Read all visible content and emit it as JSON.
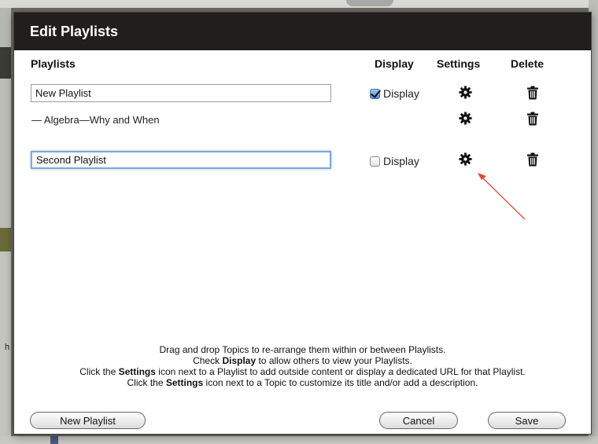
{
  "dialog": {
    "title": "Edit Playlists"
  },
  "columns": {
    "playlists": "Playlists",
    "display": "Display",
    "settings": "Settings",
    "delete": "Delete"
  },
  "rows": [
    {
      "type": "playlist",
      "name": "New Playlist",
      "display_label": "Display",
      "display_checked": true
    },
    {
      "type": "topic",
      "name": "— Algebra—Why and When"
    },
    {
      "type": "playlist",
      "name": "Second Playlist",
      "display_label": "Display",
      "display_checked": false
    }
  ],
  "instructions": {
    "line1": "Drag and drop Topics to re-arrange them within or between Playlists.",
    "line2_pre": "Check ",
    "line2_bold": "Display",
    "line2_post": " to allow others to view your Playlists.",
    "line3_pre": "Click the ",
    "line3_bold": "Settings",
    "line3_post": " icon next to a Playlist to add outside content or display a dedicated URL for that Playlist.",
    "line4_pre": "Click the ",
    "line4_bold": "Settings",
    "line4_post": " icon next to a Topic to customize its title and/or add a description."
  },
  "buttons": {
    "new_playlist": "New Playlist",
    "cancel": "Cancel",
    "save": "Save"
  },
  "background": {
    "left_glyph": "h"
  },
  "icons": {
    "settings": "gear-icon",
    "delete": "trash-icon",
    "annotation": "red-arrow"
  },
  "colors": {
    "header": "#221e1b",
    "annotation_arrow": "#e0463a",
    "focus_ring": "#7ea8d8"
  }
}
